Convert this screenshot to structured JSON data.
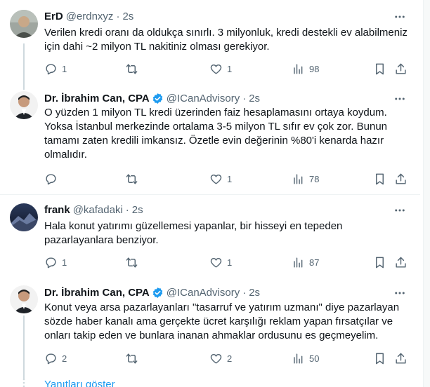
{
  "tweets": [
    {
      "name": "ErD",
      "handle": "@erdnxyz",
      "time": "2s",
      "verified": false,
      "text": "Verilen kredi oranı da oldukça sınırlı. 3 milyonluk, kredi destekli ev alabilmeniz için dahi ~2 milyon TL nakitiniz olması gerekiyor.",
      "replies": "1",
      "retweets": "",
      "likes": "1",
      "views": "98"
    },
    {
      "name": "Dr. İbrahim Can, CPA",
      "handle": "@ICanAdvisory",
      "time": "2s",
      "verified": true,
      "text": "O yüzden 1 milyon TL kredi üzerinden faiz hesaplamasını ortaya koydum. Yoksa İstanbul merkezinde ortalama 3-5 milyon TL sıfır ev çok zor. Bunun tamamı zaten kredili imkansız. Özetle evin değerinin %80'i kenarda hazır olmalıdır.",
      "replies": "",
      "retweets": "",
      "likes": "1",
      "views": "78"
    },
    {
      "name": "frank",
      "handle": "@kafadaki",
      "time": "2s",
      "verified": false,
      "text": "Hala konut yatırımı güzellemesi yapanlar, bir hisseyi en tepeden pazarlayanlara benziyor.",
      "replies": "1",
      "retweets": "",
      "likes": "1",
      "views": "87"
    },
    {
      "name": "Dr. İbrahim Can, CPA",
      "handle": "@ICanAdvisory",
      "time": "2s",
      "verified": true,
      "text": "Konut veya arsa pazarlayanları \"tasarruf ve yatırım uzmanı\" diye pazarlayan sözde haber kanalı ama gerçekte ücret karşılığı reklam yapan fırsatçılar ve onları takip eden ve bunlara inanan ahmaklar ordusunu es geçmeyelim.",
      "replies": "2",
      "retweets": "",
      "likes": "2",
      "views": "50"
    }
  ],
  "show_replies": "Yanıtları göster",
  "colors": {
    "accent": "#1d9bf0",
    "muted": "#536471",
    "text": "#0f1419",
    "border": "#eff3f4"
  },
  "icons": [
    "reply-icon",
    "retweet-icon",
    "like-icon",
    "views-icon",
    "bookmark-icon",
    "share-icon",
    "more-icon",
    "verified-icon"
  ]
}
